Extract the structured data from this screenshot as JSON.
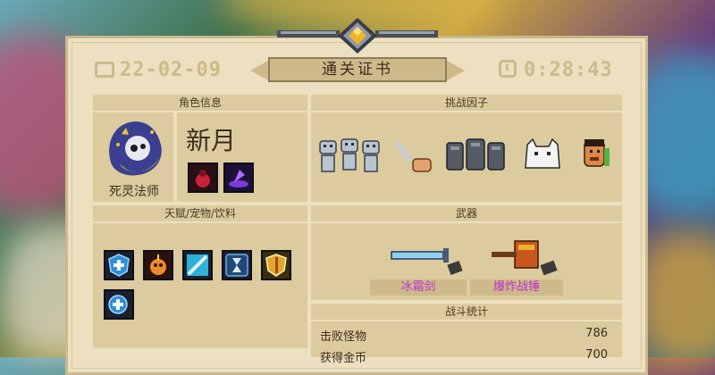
{
  "certificate": {
    "title": "通关证书",
    "date": "22-02-09",
    "time": "0:28:43"
  },
  "character": {
    "header": "角色信息",
    "name": "新月",
    "class": "死灵法师"
  },
  "challenge": {
    "header": "挑战因子"
  },
  "talents": {
    "header": "天赋/宠物/饮料"
  },
  "weapons": {
    "header": "武器",
    "items": [
      "冰霜剑",
      "爆炸战锤"
    ]
  },
  "stats": {
    "header": "战斗统计",
    "rows": [
      {
        "label": "击败怪物",
        "value": "786"
      },
      {
        "label": "获得金币",
        "value": "700"
      }
    ]
  },
  "colors": {
    "paper": "#ece0c0",
    "panel": "#dccb9e",
    "accent_text": "#c22fd0",
    "faded": "#cdb98a"
  },
  "icons": [
    "calendar-icon",
    "clock-icon",
    "crest-gem-icon",
    "necromancer-portrait",
    "skeleton-horde-icon",
    "sword-hand-icon",
    "dark-golems-icon",
    "white-beast-icon",
    "tiki-mask-icon",
    "shield-cross-icon",
    "bomb-icon",
    "blue-blade-icon",
    "hourglass-icon",
    "gold-shield-icon",
    "brain-plus-icon",
    "frost-sword-icon",
    "explosive-hammer-icon"
  ]
}
